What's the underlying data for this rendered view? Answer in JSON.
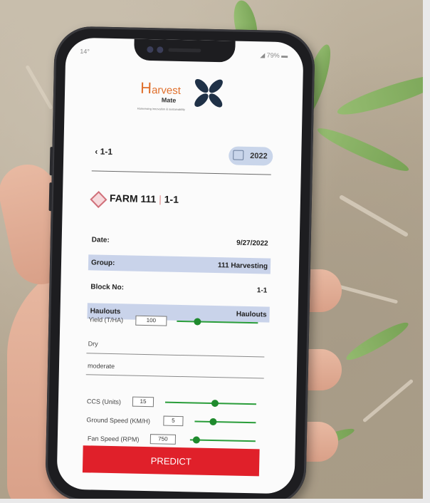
{
  "status_bar": {
    "time": "14°",
    "battery": "79%"
  },
  "logo": {
    "brand_h": "H",
    "brand_rest": "arvest",
    "sub": "Mate",
    "tagline": "Harnessing innovation & sustainability"
  },
  "header": {
    "back_label": "1-1",
    "year": "2022"
  },
  "farm": {
    "name": "FARM 111",
    "separator": "|",
    "block": "1-1"
  },
  "details": [
    {
      "key": "Date:",
      "value": "9/27/2022",
      "shaded": false
    },
    {
      "key": "Group:",
      "value": "111 Harvesting",
      "shaded": true
    },
    {
      "key": "Block No:",
      "value": "1-1",
      "shaded": false
    },
    {
      "key": "Haulouts",
      "value": "Haulouts",
      "shaded": true
    }
  ],
  "inputs": {
    "yield": {
      "label": "Yield (T/HA)",
      "value": "100",
      "slider": 0.25
    },
    "condition": "Dry",
    "intensity": "moderate",
    "ccs": {
      "label": "CCS (Units)",
      "value": "15",
      "slider": 0.55
    },
    "ground_speed": {
      "label": "Ground Speed (KM/H)",
      "value": "5",
      "slider": 0.3
    },
    "fan_speed": {
      "label": "Fan Speed (RPM)",
      "value": "750",
      "slider": 0.1
    }
  },
  "predict_label": "PREDICT",
  "colors": {
    "accent_green": "#2a9d3a",
    "predict_red": "#e0202a",
    "shade_blue": "#c9d3ea",
    "logo_orange": "#e0702d"
  }
}
